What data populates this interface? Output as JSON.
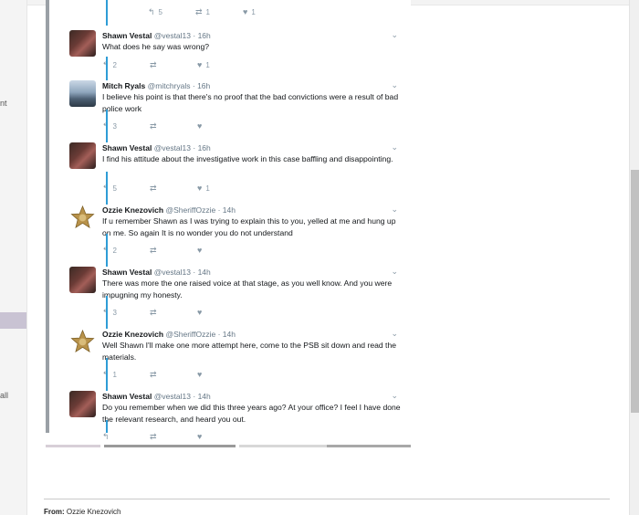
{
  "sidebar_fragments": [
    "nt",
    "all"
  ],
  "top_actions": {
    "replies": "5",
    "retweets": "1",
    "likes": "1"
  },
  "tweets": [
    {
      "name": "Shawn Vestal",
      "handle": "@vestal13",
      "time": "· 16h",
      "text": "What does he say was wrong?",
      "replies": "2",
      "retweets": "",
      "likes": "1",
      "avatar": "shawn-avatar"
    },
    {
      "name": "Mitch Ryals",
      "handle": "@mitchryals",
      "time": "· 16h",
      "text": "I believe his point is that there's no proof that the bad convictions were a result of bad police work",
      "replies": "3",
      "retweets": "",
      "likes": "",
      "avatar": "mitch-avatar"
    },
    {
      "name": "Shawn Vestal",
      "handle": "@vestal13",
      "time": "· 16h",
      "text": "I find his attitude about the investigative work in this case baffling and disappointing.",
      "replies": "5",
      "retweets": "",
      "likes": "1",
      "avatar": "shawn-avatar"
    },
    {
      "name": "Ozzie Knezovich",
      "handle": "@SheriffOzzie",
      "time": "· 14h",
      "text": "If u remember Shawn as I was trying to explain this to you, yelled at me and hung up on me.  So again It is no wonder you do not understand",
      "replies": "2",
      "retweets": "",
      "likes": "",
      "avatar": "sheriff-star-avatar"
    },
    {
      "name": "Shawn Vestal",
      "handle": "@vestal13",
      "time": "· 14h",
      "text": "There was more the one raised voice at that stage, as you well know. And you were impugning my honesty.",
      "replies": "3",
      "retweets": "",
      "likes": "",
      "avatar": "shawn-avatar"
    },
    {
      "name": "Ozzie Knezovich",
      "handle": "@SheriffOzzie",
      "time": "· 14h",
      "text": "Well Shawn I'll make one more attempt here, come to the PSB sit down and read the materials.",
      "replies": "1",
      "retweets": "",
      "likes": "",
      "avatar": "sheriff-star-avatar"
    },
    {
      "name": "Shawn Vestal",
      "handle": "@vestal13",
      "time": "· 14h",
      "text": "Do you remember when we did this three years ago? At your office? I feel I have done the relevant research, and heard you out.",
      "replies": "",
      "retweets": "",
      "likes": "",
      "avatar": "shawn-avatar"
    }
  ],
  "icons": {
    "reply": "reply-icon",
    "retweet": "retweet-icon",
    "like": "heart-icon",
    "caret": "chevron-down-icon"
  },
  "email": {
    "from_label": "From:",
    "from_value": "Ozzie Knezovich"
  },
  "colors": {
    "thread_connector": "#2e9dd6",
    "left_bar": "#9aa0a6",
    "muted": "#8899a6"
  }
}
